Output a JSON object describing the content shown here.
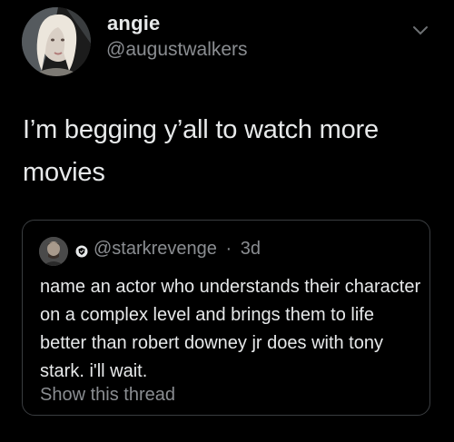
{
  "author": {
    "display_name": "angie",
    "handle": "@augustwalkers"
  },
  "tweet": {
    "text": "I’m begging y’all to watch more movies"
  },
  "quote": {
    "handle": "@starkrevenge",
    "separator": "·",
    "time": "3d",
    "text": "name an actor who understands their character on a complex level and brings them to life better than robert downey jr does with tony stark. i'll wait.",
    "show_thread": "Show this thread"
  },
  "icons": {
    "menu": "chevron-down-icon",
    "quote_badge": "shield-icon"
  },
  "colors": {
    "background": "#000000",
    "text": "#e7e9ea",
    "secondary_text": "#8a8d91",
    "border": "#3a3d40"
  }
}
